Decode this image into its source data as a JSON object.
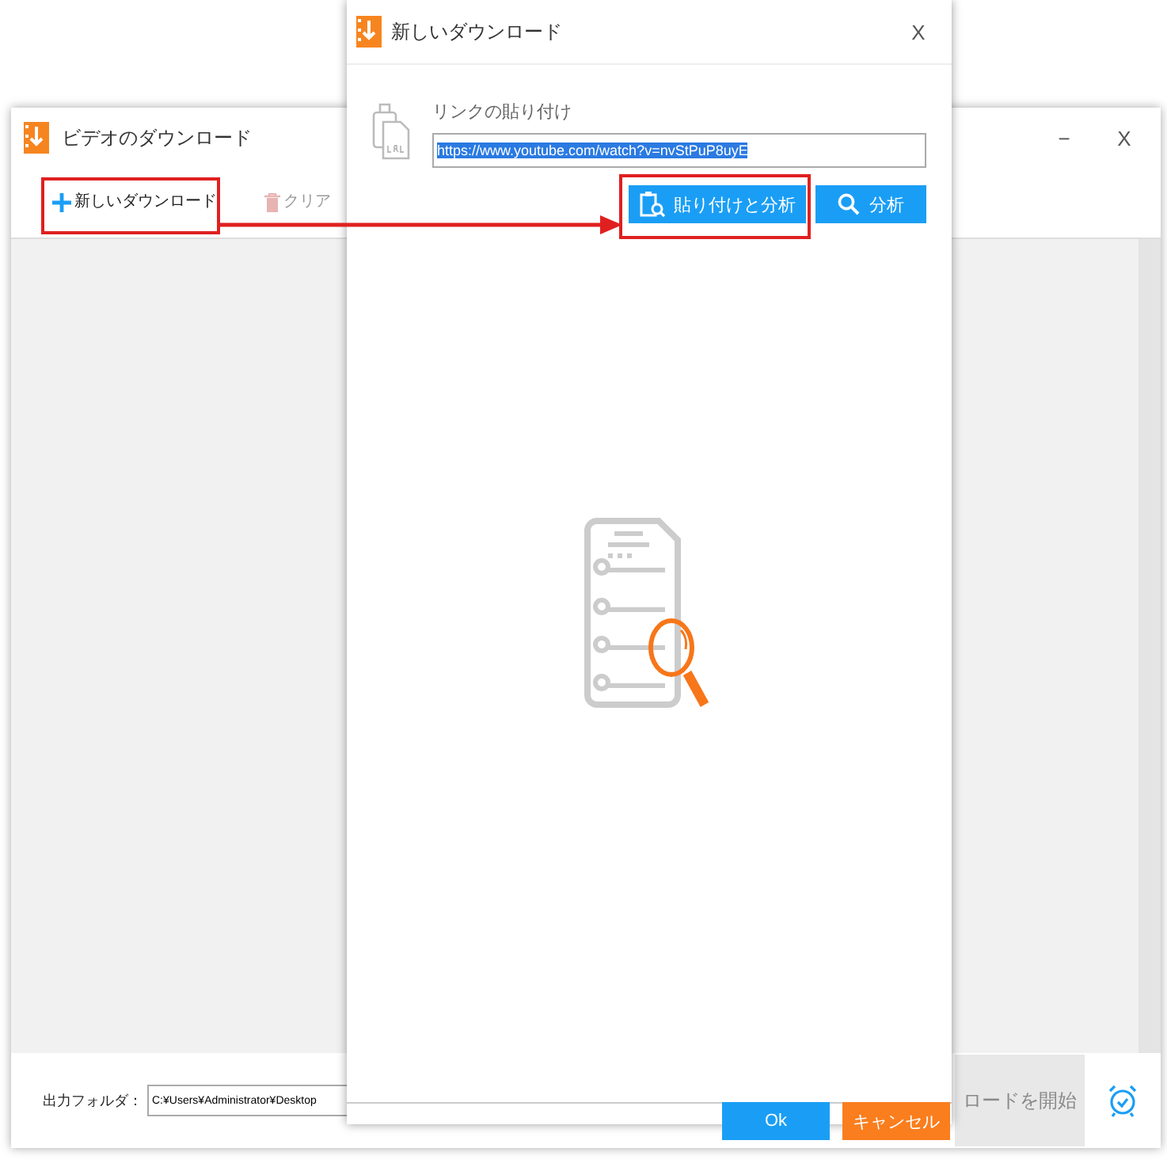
{
  "main_window": {
    "title": "ビデオのダウンロード",
    "minimize": "−",
    "close": "X",
    "toolbar": [
      {
        "label": "新しいダウンロード",
        "disabled": false
      },
      {
        "label": "クリア",
        "disabled": true
      }
    ],
    "output_folder": {
      "label": "出力フォルダ：",
      "value": "C:¥Users¥Administrator¥Desktop"
    },
    "start_button": {
      "label": "ロードを開始",
      "disabled": true
    }
  },
  "dialog": {
    "title": "新しいダウンロード",
    "close": "X",
    "link_label": "リンクの貼り付け",
    "url": "https://www.youtube.com/watch?v=nvStPuP8uyE",
    "url_selected": true,
    "buttons": [
      {
        "label": "貼り付けと分析"
      },
      {
        "label": "分析"
      }
    ],
    "footer_buttons": [
      {
        "kind": "primary",
        "label": "Ok"
      },
      {
        "kind": "cancel",
        "label": "キャンセル"
      }
    ]
  }
}
